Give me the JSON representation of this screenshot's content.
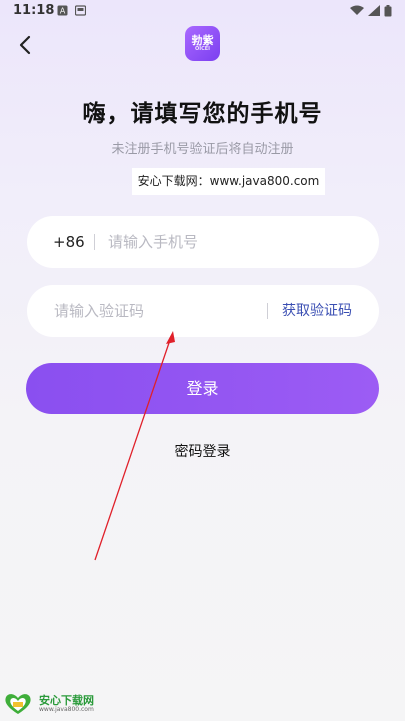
{
  "status_bar": {
    "time": "11:18",
    "left_icons": [
      "a-letter-icon",
      "image-icon"
    ],
    "right_icons": [
      "wifi-icon",
      "signal-icon",
      "battery-icon"
    ]
  },
  "header": {
    "back_icon": "chevron-left-icon",
    "logo_text": "勃紫",
    "logo_subtext": "OICEI"
  },
  "title": "嗨，请填写您的手机号",
  "subtitle": "未注册手机号验证后将自动注册",
  "watermark": "安心下载网：www.java800.com",
  "phone_field": {
    "country_code": "+86",
    "placeholder": "请输入手机号",
    "value": ""
  },
  "code_field": {
    "placeholder": "请输入验证码",
    "value": "",
    "get_code_label": "获取验证码"
  },
  "login_button": "登录",
  "password_login": "密码登录",
  "site_logo": {
    "name": "安心下载网",
    "url": "www.java800.com"
  },
  "colors": {
    "accent": "#8a4ff0",
    "link": "#3b4fb3",
    "annotation": "#e0202a"
  }
}
